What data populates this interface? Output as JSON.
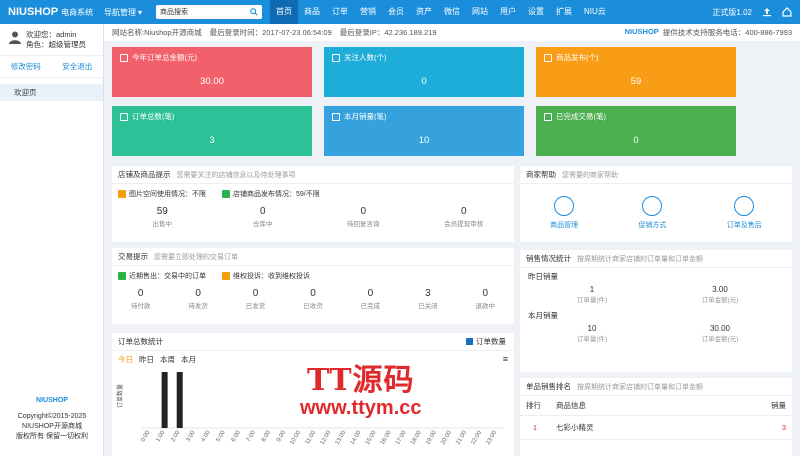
{
  "topbar": {
    "logo": "NIUSHOP",
    "logo_sub": "电商系统",
    "nav_manage": "导航管理",
    "search_placeholder": "商品搜索",
    "menu": [
      "首页",
      "商品",
      "订单",
      "营销",
      "会员",
      "资产",
      "微信",
      "网站",
      "用户",
      "设置",
      "扩展",
      "NIU云"
    ],
    "version": "正式版1.02"
  },
  "sidebar": {
    "welcome": "欢迎您：admin",
    "role": "角色：超级管理员",
    "edit_pwd": "修改密码",
    "logout": "安全退出",
    "item": "欢迎页",
    "foot_logo": "NIUSHOP",
    "copyright": "Copyright©2015-2025",
    "company": "NIUSHOP开源商城",
    "rights": "版权所有 保留一切权利"
  },
  "info": {
    "site_name": "网站名称:Niushop开源商城",
    "last_login_time": "最后登录时间：2017-07-23 06:54:09",
    "last_login_ip": "最后登录IP：42.236.189.219",
    "brand": "NIUSHOP",
    "support": "提供技术支持服务电话：400-886-7993"
  },
  "cards": [
    {
      "title": "今年订单总金额(元)",
      "value": "30.00",
      "color": "#f2616b"
    },
    {
      "title": "关注人数(个)",
      "value": "0",
      "color": "#1eadd9"
    },
    {
      "title": "商品发布(个)",
      "value": "59",
      "color": "#fa9d16"
    },
    {
      "title": "订单总数(笔)",
      "value": "3",
      "color": "#2cc197"
    },
    {
      "title": "本月销量(笔)",
      "value": "10",
      "color": "#36a2dd"
    },
    {
      "title": "已完成交易(笔)",
      "value": "0",
      "color": "#4caf50"
    }
  ],
  "store": {
    "title": "店铺及商品提示",
    "sub": "您需要关注的店铺信息以及待处理事项",
    "tag1": "图片空间使用情况：不限",
    "tag2": "店铺商品发布情况：59/不限",
    "stats": [
      {
        "n": "59",
        "l": "出售中"
      },
      {
        "n": "0",
        "l": "仓库中"
      },
      {
        "n": "0",
        "l": "待回复咨询"
      },
      {
        "n": "0",
        "l": "会员提现审核"
      }
    ]
  },
  "trade": {
    "title": "交易提示",
    "sub": "您需要立即处理的交易订单",
    "tag1": "近期售出：交易中的订单",
    "tag2": "维权投诉：收到维权投诉",
    "stats": [
      {
        "n": "0",
        "l": "待付款"
      },
      {
        "n": "0",
        "l": "待发货"
      },
      {
        "n": "0",
        "l": "已发货"
      },
      {
        "n": "0",
        "l": "已收货"
      },
      {
        "n": "0",
        "l": "已完成"
      },
      {
        "n": "3",
        "l": "已关闭"
      },
      {
        "n": "0",
        "l": "退款中"
      }
    ]
  },
  "help": {
    "title": "商家帮助",
    "sub": "您需要的商家帮助",
    "items": [
      "商品管理",
      "促销方式",
      "订单及售后"
    ]
  },
  "sales": {
    "title": "销售情况统计",
    "sub": "按周期统计商家店铺的订单量和订单金额",
    "yesterday": "昨日销量",
    "y_count": "1",
    "y_amount": "3.00",
    "month": "本月销量",
    "m_count": "10",
    "m_amount": "30.00",
    "count_label": "订单量(件)",
    "amount_label": "订单金额(元)"
  },
  "rank": {
    "title": "单品销售排名",
    "sub": "按周期统计商家店铺的订单量和订单金额",
    "headers": [
      "排行",
      "商品信息",
      "销量"
    ],
    "rows": [
      {
        "rank": "1",
        "name": "七彩小精灵",
        "qty": "3"
      }
    ]
  },
  "chart_panel": {
    "title": "订单总数统计",
    "legend": "订单数量",
    "tabs": [
      "今日",
      "昨日",
      "本周",
      "本月"
    ],
    "ylabel": "订单数量"
  },
  "chart_data": {
    "type": "bar",
    "categories": [
      "0:00",
      "1:00",
      "2:00",
      "3:00",
      "4:00",
      "5:00",
      "6:00",
      "7:00",
      "8:00",
      "9:00",
      "10:00",
      "11:00",
      "12:00",
      "13:00",
      "14:00",
      "15:00",
      "16:00",
      "17:00",
      "18:00",
      "19:00",
      "20:00",
      "21:00",
      "22:00",
      "23:00"
    ],
    "values": [
      0,
      1,
      1,
      0,
      0,
      0,
      0,
      0,
      0,
      0,
      0,
      0,
      0,
      0,
      0,
      0,
      0,
      0,
      0,
      0,
      0,
      0,
      0,
      0
    ],
    "ylim": [
      0,
      1
    ],
    "color": "#222222"
  },
  "watermark": {
    "big": "TT源码",
    "small": "www.ttym.cc"
  }
}
